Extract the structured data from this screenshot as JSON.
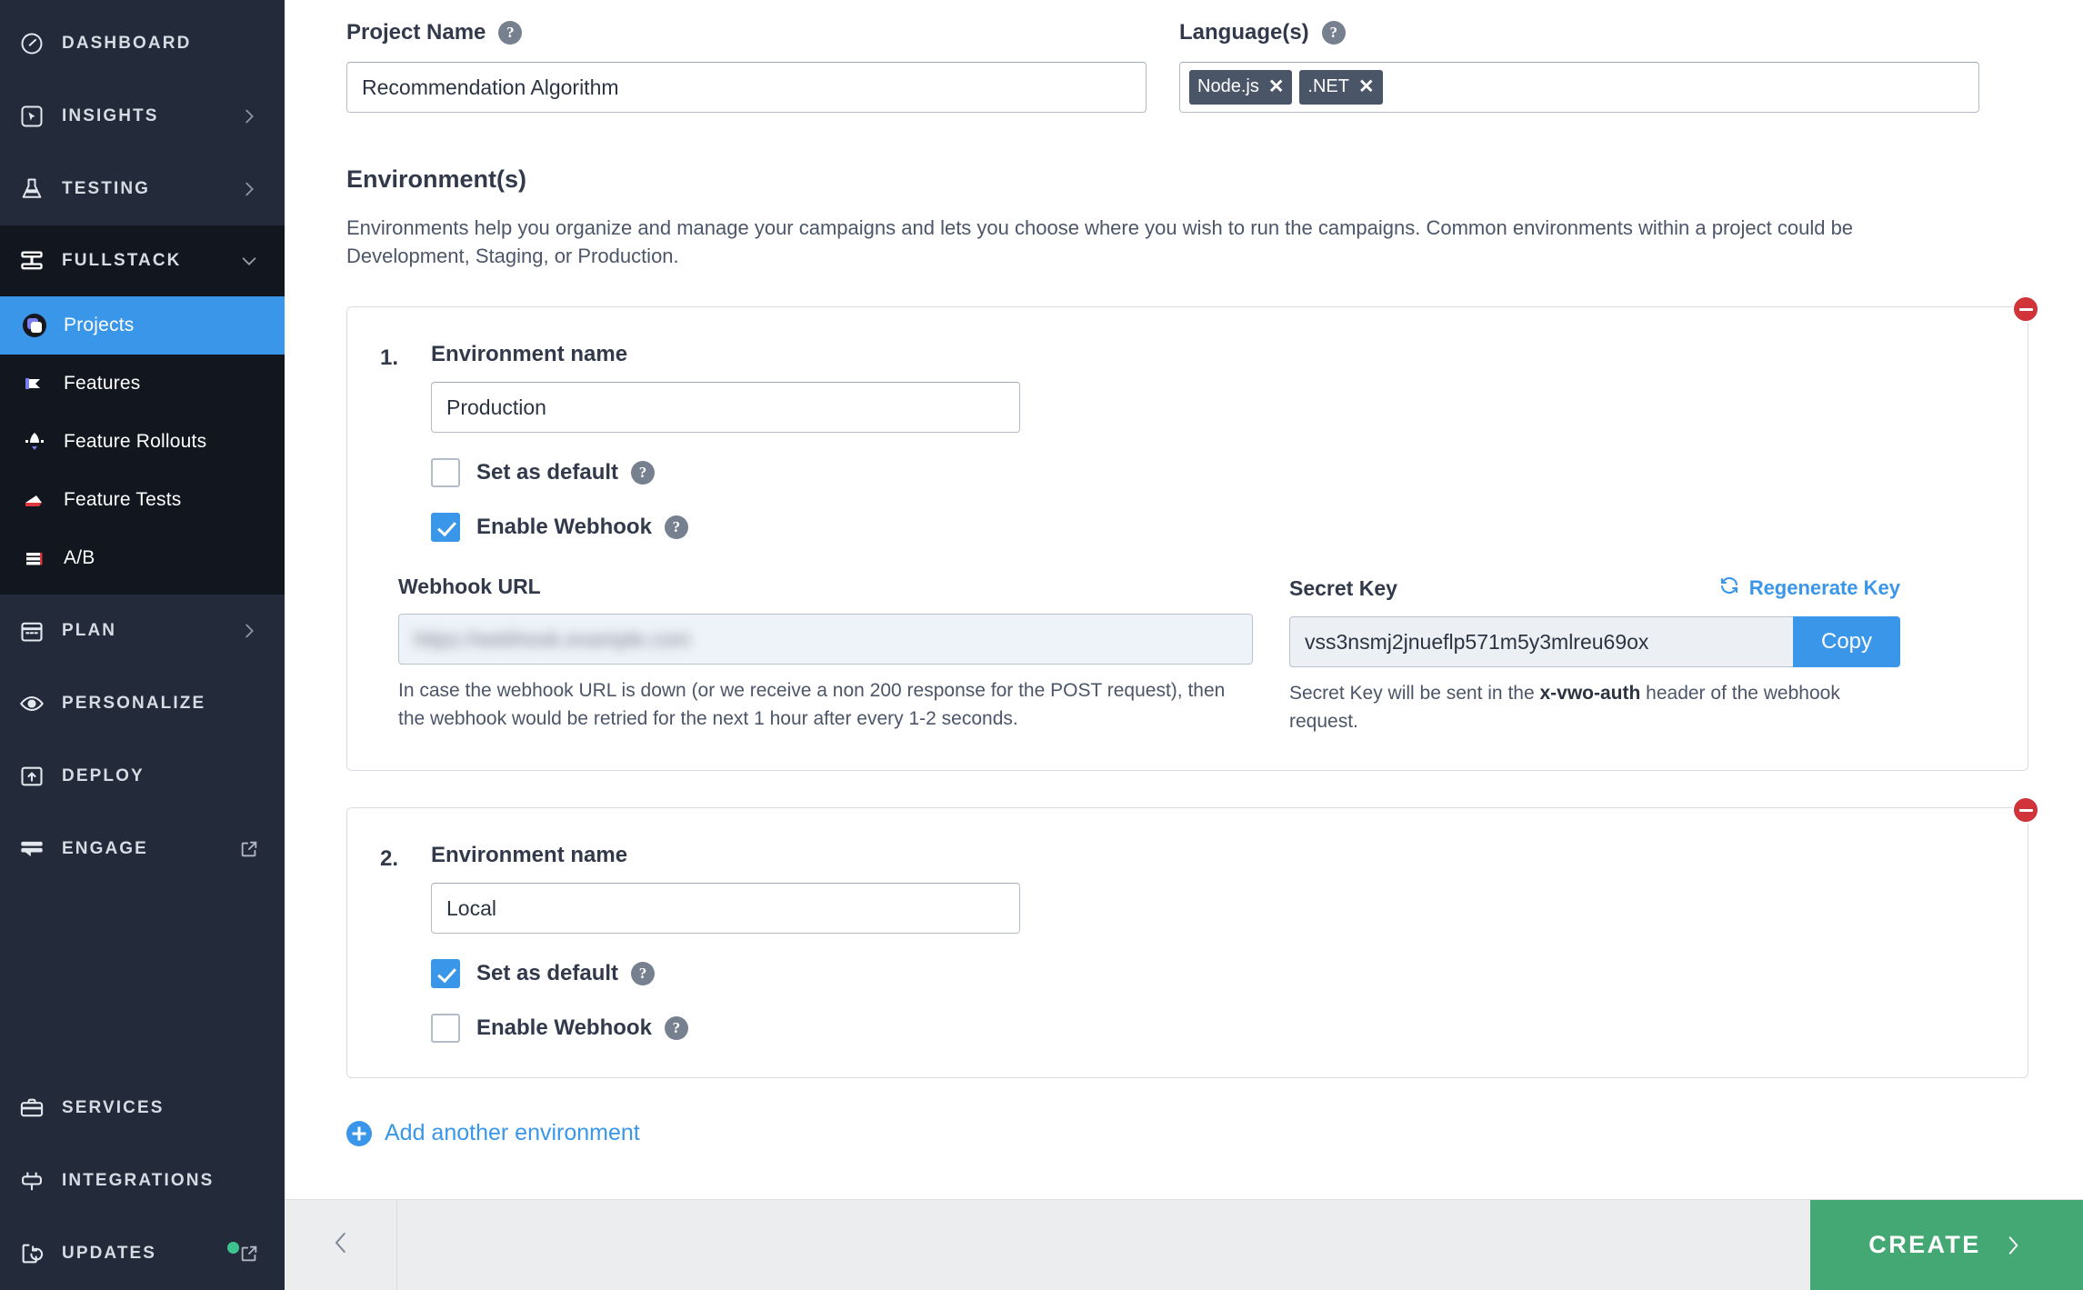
{
  "sidebar": {
    "top_items": [
      {
        "label": "DASHBOARD",
        "icon": "speedometer-icon",
        "chevron": false,
        "external": false
      },
      {
        "label": "INSIGHTS",
        "icon": "insights-cursor-icon",
        "chevron": true,
        "external": false
      },
      {
        "label": "TESTING",
        "icon": "flask-icon",
        "chevron": true,
        "external": false
      }
    ],
    "group": {
      "label": "FULLSTACK",
      "icon": "fullstack-icon",
      "chevron": "down"
    },
    "sub_items": [
      {
        "label": "Projects",
        "icon": "projects-icon",
        "active": true
      },
      {
        "label": "Features",
        "icon": "features-flag-icon",
        "active": false
      },
      {
        "label": "Feature Rollouts",
        "icon": "rocket-icon",
        "active": false
      },
      {
        "label": "Feature Tests",
        "icon": "feature-tests-icon",
        "active": false
      },
      {
        "label": "A/B",
        "icon": "ab-bars-icon",
        "active": false
      }
    ],
    "mid_items": [
      {
        "label": "PLAN",
        "icon": "calendar-icon",
        "chevron": true,
        "external": false
      },
      {
        "label": "PERSONALIZE",
        "icon": "eye-target-icon",
        "chevron": false,
        "external": false
      },
      {
        "label": "DEPLOY",
        "icon": "deploy-upload-icon",
        "chevron": false,
        "external": false
      },
      {
        "label": "ENGAGE",
        "icon": "engage-chat-icon",
        "chevron": false,
        "external": true
      }
    ],
    "bottom_items": [
      {
        "label": "SERVICES",
        "icon": "toolbox-icon",
        "chevron": false,
        "external": false,
        "badge": false
      },
      {
        "label": "INTEGRATIONS",
        "icon": "integrations-plug-icon",
        "chevron": false,
        "external": false,
        "badge": false
      },
      {
        "label": "UPDATES",
        "icon": "updates-refresh-icon",
        "chevron": false,
        "external": true,
        "badge": true
      }
    ]
  },
  "form": {
    "project_name": {
      "label": "Project Name",
      "value": "Recommendation Algorithm",
      "placeholder": "Project Name"
    },
    "languages": {
      "label": "Language(s)",
      "tags": [
        "Node.js",
        ".NET"
      ],
      "placeholder": "Select languages"
    }
  },
  "environments_section": {
    "title": "Environment(s)",
    "description": "Environments help you organize and manage your campaigns and lets you choose where you wish to run the campaigns. Common environments within a project could be Development, Staging, or Production.",
    "add_link": "Add another environment"
  },
  "environments": [
    {
      "number": "1.",
      "name_label": "Environment name",
      "name_value": "Production",
      "name_placeholder": "Environment name",
      "set_default_label": "Set as default",
      "set_default_checked": false,
      "enable_webhook_label": "Enable Webhook",
      "enable_webhook_checked": true,
      "webhook": {
        "url_label": "Webhook URL",
        "url_value": "https://webhook.example.com",
        "url_redacted": true,
        "url_hint": "In case the webhook URL is down (or we receive a non 200 response for the POST request), then the webhook would be retried for the next 1 hour after every 1-2 seconds.",
        "secret_label": "Secret Key",
        "regenerate_label": "Regenerate Key",
        "secret_value": "vss3nsmj2jnueflp571m5y3mlreu69ox",
        "copy_label": "Copy",
        "secret_hint_pre": "Secret Key will be sent in the ",
        "secret_hint_bold": "x-vwo-auth",
        "secret_hint_post": " header of the webhook request."
      }
    },
    {
      "number": "2.",
      "name_label": "Environment name",
      "name_value": "Local",
      "name_placeholder": "Environment name",
      "set_default_label": "Set as default",
      "set_default_checked": true,
      "enable_webhook_label": "Enable Webhook",
      "enable_webhook_checked": false
    }
  ],
  "footer": {
    "back_label": "",
    "create_label": "CREATE"
  },
  "colors": {
    "sidebar_bg": "#232b3b",
    "sidebar_group_bg": "#11161f",
    "accent_blue": "#3a96e8",
    "create_green": "#43a873",
    "remove_red": "#d0343a",
    "badge_green": "#3ec28f"
  }
}
